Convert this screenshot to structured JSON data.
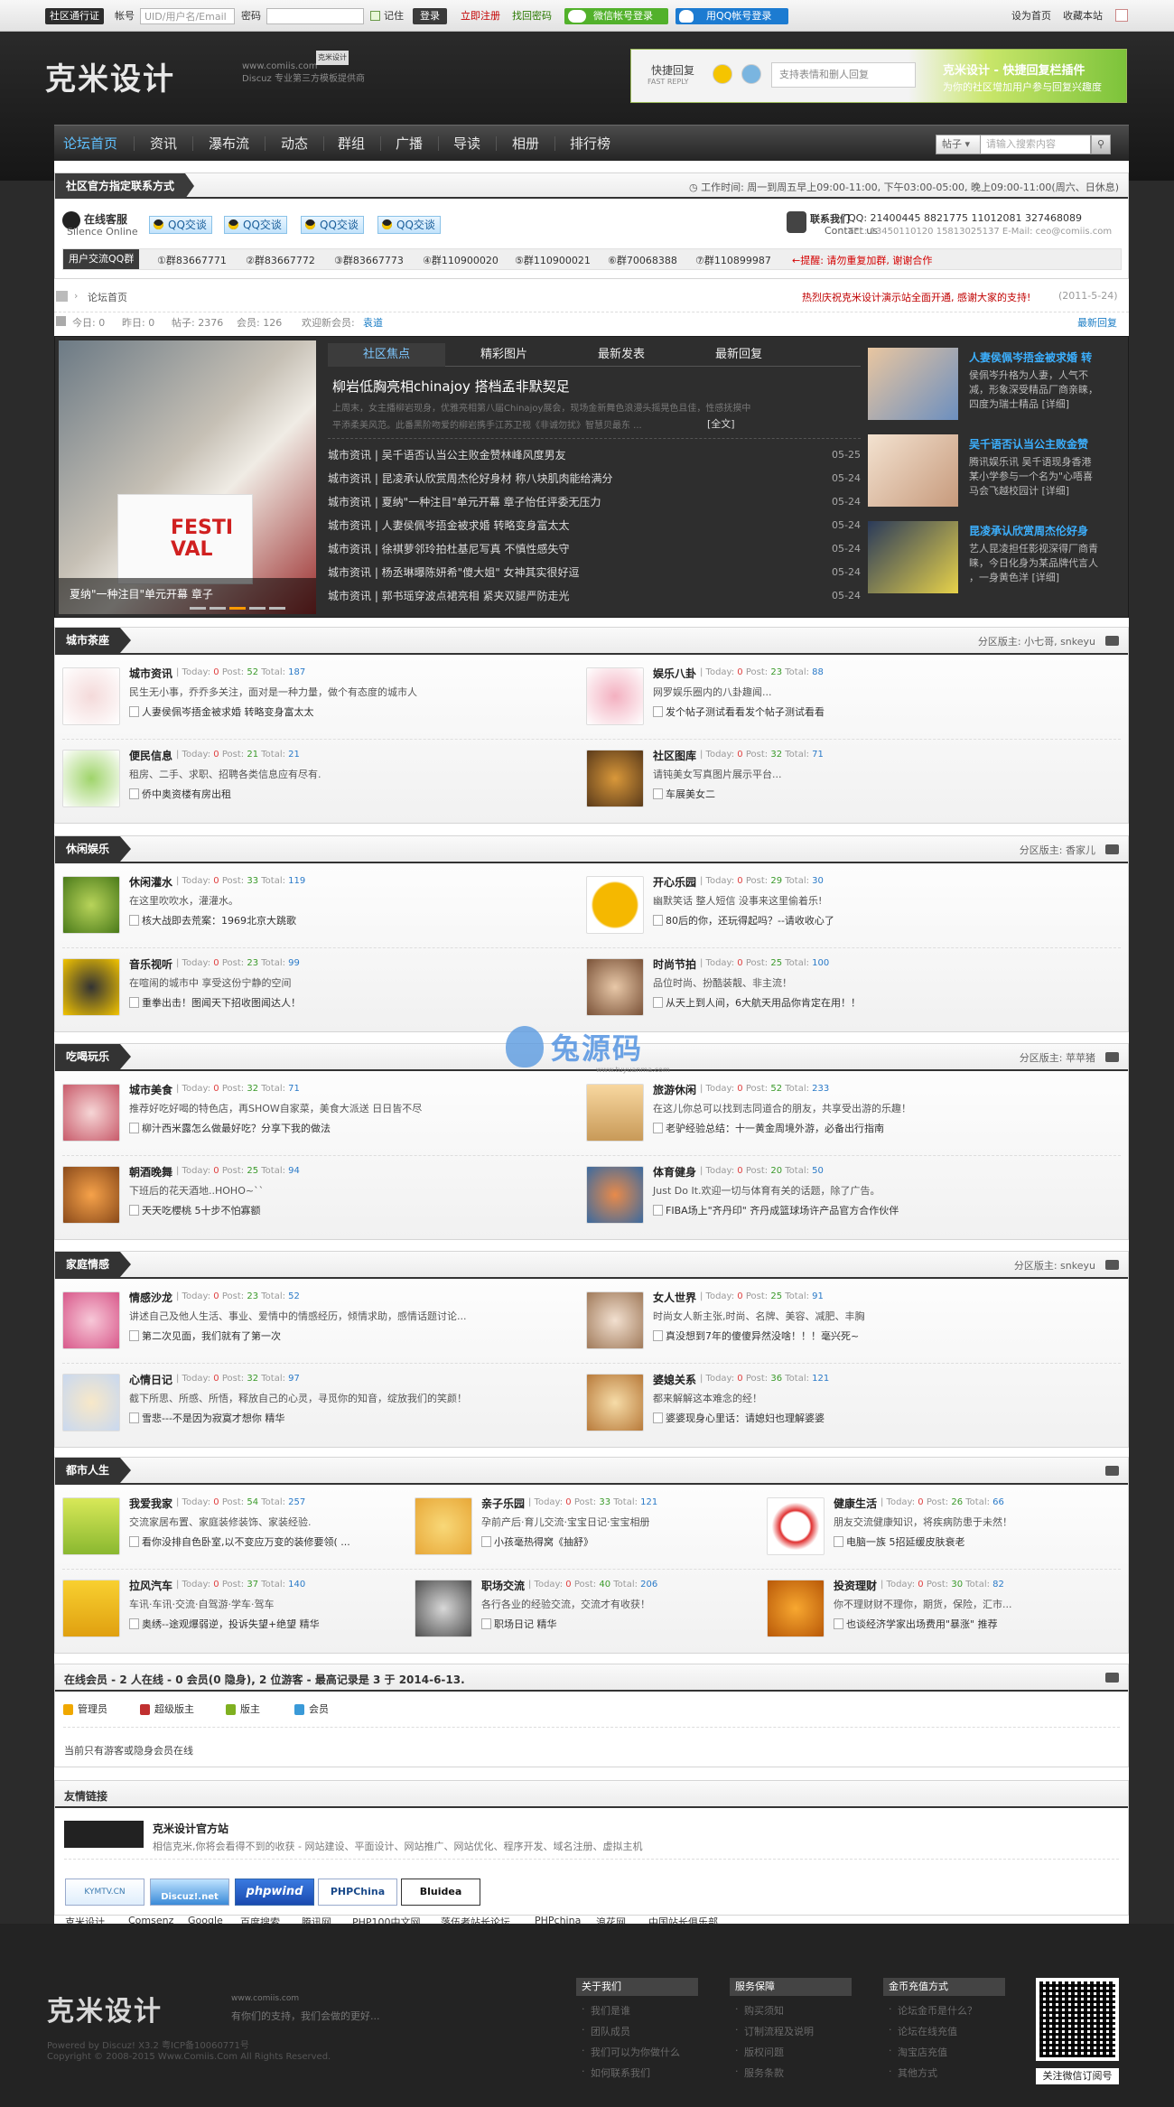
{
  "topbar": {
    "switch_label": "社区通行证",
    "account_label": "帐号",
    "account_placeholder": "UID/用户名/Email",
    "password_label": "密码",
    "remember_label": "记住",
    "login_button": "登录",
    "register_link": "立即注册",
    "findpw_link": "找回密码",
    "wechat_login": "微信帐号登录",
    "qq_login": "用QQ帐号登录",
    "set_home": "设为首页",
    "bookmark": "收藏本站"
  },
  "header": {
    "logo_text": "克米设计",
    "logo_url": "www.comiis.com",
    "logo_tagline": "Discuz 专业第三方模板提供商",
    "logo_badge": "克米设计",
    "fast_reply_cn": "快捷回复",
    "fast_reply_en": "FAST REPLY",
    "reply_tip": "支持表情和删人回复",
    "reply_promo_title": "克米设计 - 快捷回复栏插件",
    "reply_promo_sub": "为你的社区增加用户参与回复兴趣度"
  },
  "nav": {
    "items": [
      "论坛首页",
      "资讯",
      "瀑布流",
      "动态",
      "群组",
      "广播",
      "导读",
      "相册",
      "排行榜"
    ],
    "search_type": "帖子",
    "search_placeholder": "请输入搜索内容"
  },
  "contact": {
    "title": "社区官方指定联系方式",
    "hours": "工作时间: 周一到周五早上09:00-11:00, 下午03:00-05:00, 晚上09:00-11:00(周六、日休息)",
    "service_cn": "在线客服",
    "service_en": "Silence Online",
    "qq_buttons": [
      "QQ交谈",
      "QQ交谈",
      "QQ交谈",
      "QQ交谈"
    ],
    "contact_cn": "联系我们",
    "contact_en": "Contact us",
    "qq_numbers": "QQ: 21400445  8821775  11012081  327468089",
    "tel": "TEL: 13450110120  15813025137  E-Mail: ceo@comiis.com",
    "group_label": "用户交流QQ群",
    "groups": [
      "①群83667771",
      "②群83667772",
      "③群83667773",
      "④群110900020",
      "⑤群110900021",
      "⑥群70068388",
      "⑦群110899987"
    ],
    "warning": "←提醒: 请勿重复加群, 谢谢合作"
  },
  "breadcrumb": {
    "home": "论坛首页",
    "announcement": "热烈庆祝克米设计演示站全面开通, 感谢大家的支持!",
    "announcement_date": "(2011-5-24)"
  },
  "stats": {
    "today": "今日: 0",
    "yesterday": "昨日: 0",
    "posts": "帖子: 2376",
    "members": "会员: 126",
    "welcome": "欢迎新会员:",
    "new_member": "袁道",
    "latest_reply": "最新回复"
  },
  "focus": {
    "slide_caption": "夏纳\"一种注目\"单元开幕 章子",
    "tabs": [
      "社区焦点",
      "精彩图片",
      "最新发表",
      "最新回复"
    ],
    "headline": "柳岩低胸亮相chinajoy 搭档孟非默契足",
    "summary_1": "上周末，女主播柳岩现身，优雅亮相第八届Chinajoy展会，现场金新舞色浪漫头摇晃色且佳，性感抚摸中",
    "summary_2": "平添柔美风范。此番黑阶吻爱的柳岩携手江苏卫视《非诚勿扰》智慧贝最东 ...",
    "full_text": "[全文]",
    "news": [
      {
        "title": "城市资讯 | 吴千语否认当公主败金赞林峰风度男友",
        "date": "05-25"
      },
      {
        "title": "城市资讯 | 昆凌承认欣赏周杰伦好身材 称八块肌肉能给满分",
        "date": "05-24"
      },
      {
        "title": "城市资讯 | 夏纳\"一种注目\"单元开幕 章子怡任评委无压力",
        "date": "05-24"
      },
      {
        "title": "城市资讯 | 人妻侯佩岑捂金被求婚 转略变身富太太",
        "date": "05-24"
      },
      {
        "title": "城市资讯 | 徐褀萝邻玲拍杜基尼写真 不慎性感失守",
        "date": "05-24"
      },
      {
        "title": "城市资讯 | 杨丞琳曝陈妍希\"傻大姐\" 女神其实很好逗",
        "date": "05-24"
      },
      {
        "title": "城市资讯 | 郭书瑶穿波点裙亮相 紧夹双腿严防走光",
        "date": "05-24"
      }
    ],
    "side": [
      {
        "title": "人妻侯佩岑捂金被求婚 转",
        "desc_1": "侯佩岑升格为人妻，人气不",
        "desc_2": "减，形象深受精品厂商亲睐，",
        "desc_3": "四度为瑞士精品",
        "more": "[详细]"
      },
      {
        "title": "吴千语否认当公主败金赞",
        "desc_1": "腾讯娱乐讯 吴千语现身香港",
        "desc_2": "某小学参与一个名为\"心唔喜",
        "desc_3": "马会飞越校园计",
        "more": "[详细]"
      },
      {
        "title": "昆凌承认欣赏周杰伦好身",
        "desc_1": "艺人昆凌担任影视深得厂商青",
        "desc_2": "睐，今日化身为某品牌代言人",
        "desc_3": "，一身黄色洋",
        "more": "[详细]"
      }
    ]
  },
  "categories": [
    {
      "name": "城市茶座",
      "moderators": "分区版主: 小七哥, snkeyu",
      "forums": [
        {
          "name": "城市资讯",
          "stat": "| Today: 0 Post: 52 Total: 187",
          "desc": "民生无小事，乔乔多关注，面对是一种力量，做个有态度的城市人",
          "last": "人妻侯佩岑捂金被求婚 转略变身富太太"
        },
        {
          "name": "娱乐八卦",
          "stat": "| Today: 0 Post: 23 Total: 88",
          "desc": "网罗娱乐圈内的八卦趣闻...",
          "last": "发个帖子测试看看发个帖子测试看看"
        },
        {
          "name": "便民信息",
          "stat": "| Today: 0 Post: 21 Total: 21",
          "desc": "租房、二手、求职、招聘各类信息应有尽有.",
          "last": "侨中奥资楼有房出租"
        },
        {
          "name": "社区图库",
          "stat": "| Today: 0 Post: 32 Total: 71",
          "desc": "请钝美女写真图片展示平台...",
          "last": "车展美女二"
        }
      ]
    },
    {
      "name": "休闲娱乐",
      "moderators": "分区版主: 香家儿",
      "forums": [
        {
          "name": "休闲灌水",
          "stat": "| Today: 0 Post: 33 Total: 119",
          "desc": "在这里吹吹水，灌灌水。",
          "last": "核大战即去荒案：1969北京大跳歌"
        },
        {
          "name": "开心乐园",
          "stat": "| Today: 0 Post: 29 Total: 30",
          "desc": "幽默笑话 整人短信 没事来这里偷着乐!",
          "last": "80后的你，还玩得起吗？--请收收心了"
        },
        {
          "name": "音乐视听",
          "stat": "| Today: 0 Post: 23 Total: 99",
          "desc": "在喧闹的城市中 享受这份宁静的空间",
          "last": "重拳出击！图闻天下招收图闻达人！"
        },
        {
          "name": "时尚节拍",
          "stat": "| Today: 0 Post: 25 Total: 100",
          "desc": "品位时尚、扮酷装靓、非主流！",
          "last": "从天上到人间，6大航天用品你肯定在用！！"
        }
      ]
    },
    {
      "name": "吃喝玩乐",
      "moderators": "分区版主: 苹苹猪",
      "forums": [
        {
          "name": "城市美食",
          "stat": "| Today: 0 Post: 32 Total: 71",
          "desc": "推荐好吃好喝的特色店，再SHOW自家菜，美食大派送 日日皆不尽",
          "last": "柳汁西米露怎么做最好吃？分享下我的做法"
        },
        {
          "name": "旅游休闲",
          "stat": "| Today: 0 Post: 52 Total: 233",
          "desc": "在这儿你总可以找到志同道合的朋友，共享受出游的乐趣！",
          "last": "老驴经验总结：十一黄金周境外游，必备出行指南"
        },
        {
          "name": "朝酒晚舞",
          "stat": "| Today: 0 Post: 25 Total: 94",
          "desc": "下班后的花天酒地..HOHO~``",
          "last": "天天吃櫻桃 5十步不怕寡额"
        },
        {
          "name": "体育健身",
          "stat": "| Today: 0 Post: 20 Total: 50",
          "desc": "Just Do It.欢迎一切与体育有关的话题，除了广告。",
          "last": "FIBA场上\"齐丹印\" 齐丹成篮球场许产品官方合作伙伴"
        }
      ]
    },
    {
      "name": "家庭情感",
      "moderators": "分区版主: snkeyu",
      "forums": [
        {
          "name": "情感沙龙",
          "stat": "| Today: 0 Post: 23 Total: 52",
          "desc": "讲述自己及他人生活、事业、爱情中的情感经历，倾情求助，感情话题讨论...",
          "last": "第二次见面，我们就有了第一次"
        },
        {
          "name": "女人世界",
          "stat": "| Today: 0 Post: 25 Total: 91",
          "desc": "时尚女人新主张,时尚、名牌、美容、减肥、丰胸",
          "last": "真没想到7年的傻傻异然没啥！！！毫兴死~"
        },
        {
          "name": "心情日记",
          "stat": "| Today: 0 Post: 32 Total: 97",
          "desc": "截下所思、所感、所悟，释放自己的心灵，寻觅你的知音，绽放我们的笑颜！",
          "last": "雪悲---不是因为寂寞才想你 精华"
        },
        {
          "name": "婆媳关系",
          "stat": "| Today: 0 Post: 36 Total: 121",
          "desc": "都来解解这本难念的经！",
          "last": "婆婆现身心里话：请媳妇也理解婆婆"
        }
      ]
    },
    {
      "name": "都市人生",
      "moderators": "",
      "forums": [
        {
          "name": "我爱我家",
          "stat": "| Today: 0 Post: 54 Total: 257",
          "desc": "交流家居布置、家庭装修装饰、家装经验.",
          "last": "看你没排自色卧室,以不变应万变的装修要领( ..."
        },
        {
          "name": "亲子乐园",
          "stat": "| Today: 0 Post: 33 Total: 121",
          "desc": "孕前产后·育儿交流·宝宝日记·宝宝相册",
          "last": "小孩毫热得窝《抽舒》"
        },
        {
          "name": "健康生活",
          "stat": "| Today: 0 Post: 26 Total: 66",
          "desc": "朋友交流健康知识，将疾病防患于未然！",
          "last": "电脑一族 5招延缓皮肤衰老"
        },
        {
          "name": "拉风汽车",
          "stat": "| Today: 0 Post: 37 Total: 140",
          "desc": "车讯·车讯·交流·自驾游·学车·驾车",
          "last": "奥绣--途观爆弱逆，投诉失望+绝望 精华"
        },
        {
          "name": "职场交流",
          "stat": "| Today: 0 Post: 40 Total: 206",
          "desc": "各行各业的经验交流，交流才有收获！",
          "last": "职场日记 精华"
        },
        {
          "name": "投资理财",
          "stat": "| Today: 0 Post: 30 Total: 82",
          "desc": "你不理财财不理你，期货，保险，汇市...",
          "last": "也谈经济学家出场费用\"暴涨\" 推荐"
        }
      ]
    }
  ],
  "online": {
    "title": "在线会员 - 2 人在线 - 0 会员(0 隐身), 2 位游客 - 最高记录是 3 于 2014-6-13.",
    "legend": [
      "管理员",
      "超级版主",
      "版主",
      "会员"
    ],
    "legend_colors": [
      "#f0a800",
      "#c03030",
      "#7fb020",
      "#3a9ad8"
    ],
    "note": "当前只有游客或隐身会员在线"
  },
  "links": {
    "title": "友情链接",
    "featured_name": "克米设计官方站",
    "featured_desc": "相信克米,你将会看得不到的收获 - 网站建设、平面设计、网站推广、网站优化、程序开发、域名注册、虚拟主机",
    "logos": [
      "KYMTV.CN",
      "Discuz!.net",
      "phpwind",
      "PHPChina",
      "Bluidea"
    ],
    "text_links": [
      "克米设计",
      "Comsenz",
      "Google",
      "百度搜索",
      "腾讯网",
      "PHP100中文网",
      "落伍者站长论坛",
      "PHPchina",
      "浪花网",
      "中国站长俱乐部"
    ]
  },
  "footer": {
    "logo_text": "克米设计",
    "logo_url": "www.comiis.com",
    "logo_tagline": "有你们的支持，我们会做的更好...",
    "powered": "Powered by Discuz! X3.2 粤ICP备10060771号",
    "copyright": "Copyright © 2008-2015 Www.Comiis.Com All Rights Reserved.",
    "columns": [
      {
        "title": "关于我们",
        "items": [
          "我们是谁",
          "团队成员",
          "我们可以为你做什么",
          "如何联系我们"
        ]
      },
      {
        "title": "服务保障",
        "items": [
          "购买须知",
          "订制流程及说明",
          "版权问题",
          "服务条款"
        ]
      },
      {
        "title": "金币充值方式",
        "items": [
          "论坛金币是什么？",
          "论坛在线充值",
          "淘宝店充值",
          "其他方式"
        ]
      }
    ],
    "qr_caption": "关注微信订阅号"
  },
  "watermark": {
    "text": "兔源码",
    "url": "www.tuyuanma.com"
  }
}
